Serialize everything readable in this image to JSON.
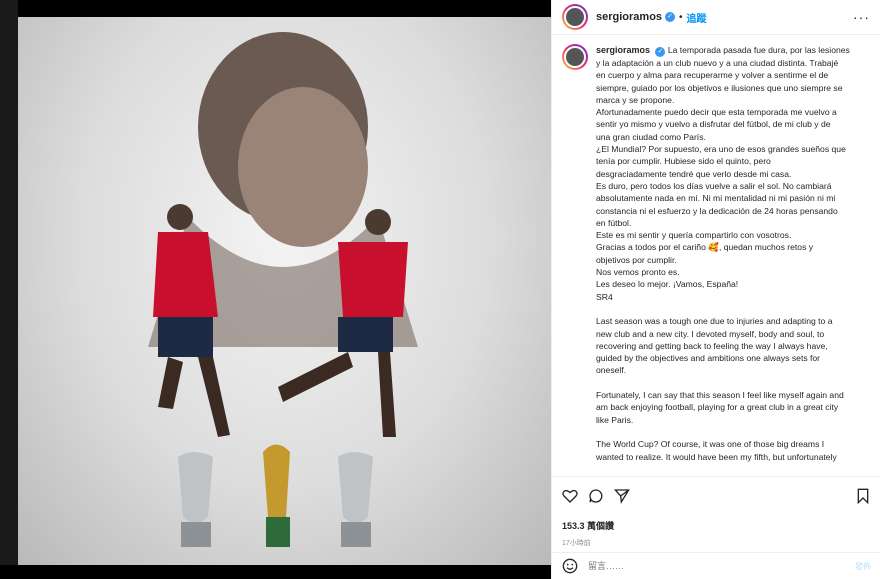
{
  "post": {
    "username": "sergioramos",
    "follow_label": "追蹤",
    "likes": "153.3 萬個讚",
    "time_ago": "17小時前",
    "caption_lines": [
      "La temporada pasada fue dura, por las lesiones",
      "y la adaptación a un club nuevo y a una ciudad distinta. Trabajé",
      "en cuerpo y alma para recuperarme y volver a sentirme el de",
      "siempre, guiado por los objetivos e ilusiones que uno siempre se",
      "marca y se propone.",
      "Afortunadamente puedo decir que esta temporada me vuelvo a",
      "sentir yo mismo y vuelvo a disfrutar del fútbol, de mi club y de",
      "una gran ciudad como París.",
      "¿El Mundial? Por supuesto, era uno de esos grandes sueños que",
      "tenía por cumplir. Hubiese sido el quinto, pero",
      "desgraciadamente tendré que verlo desde mi casa.",
      "Es duro, pero todos los días vuelve a salir el sol. No cambiará",
      "absolutamente nada en mí. Ni mi mentalidad ni mi pasión ni mi",
      "constancia ni el esfuerzo y la dedicación de 24 horas pensando",
      "en fútbol.",
      "Este es mi sentir y quería compartirlo con vosotros.",
      "Gracias a todos por el cariño 🥰, quedan muchos retos y",
      "objetivos por cumplir.",
      "Nos vemos pronto es.",
      "Les deseo lo mejor. ¡Vamos, España!",
      "SR4",
      "",
      "Last season was a tough one due to injuries and adapting to a",
      "new club and a new city. I devoted myself, body and soul, to",
      "recovering and getting back to feeling the way I always have,",
      "guided by the objectives and ambitions one always sets for",
      "oneself.",
      "",
      "Fortunately, I can say that this season I feel like myself again and",
      "am back enjoying football, playing for a great club in a great city",
      "like Paris.",
      "",
      "The World Cup? Of course, it was one of those big dreams I",
      "wanted to realize. It would have been my fifth, but unfortunately"
    ]
  },
  "comment": {
    "placeholder": "留言……",
    "post_label": "發佈"
  },
  "icons": [
    "heart-icon",
    "comment-icon",
    "share-icon",
    "bookmark-icon",
    "emoji-icon",
    "more-icon",
    "verified-icon"
  ],
  "colors": {
    "accent": "#0095f6",
    "verified": "#3897f0",
    "jersey": "#c8102e"
  }
}
